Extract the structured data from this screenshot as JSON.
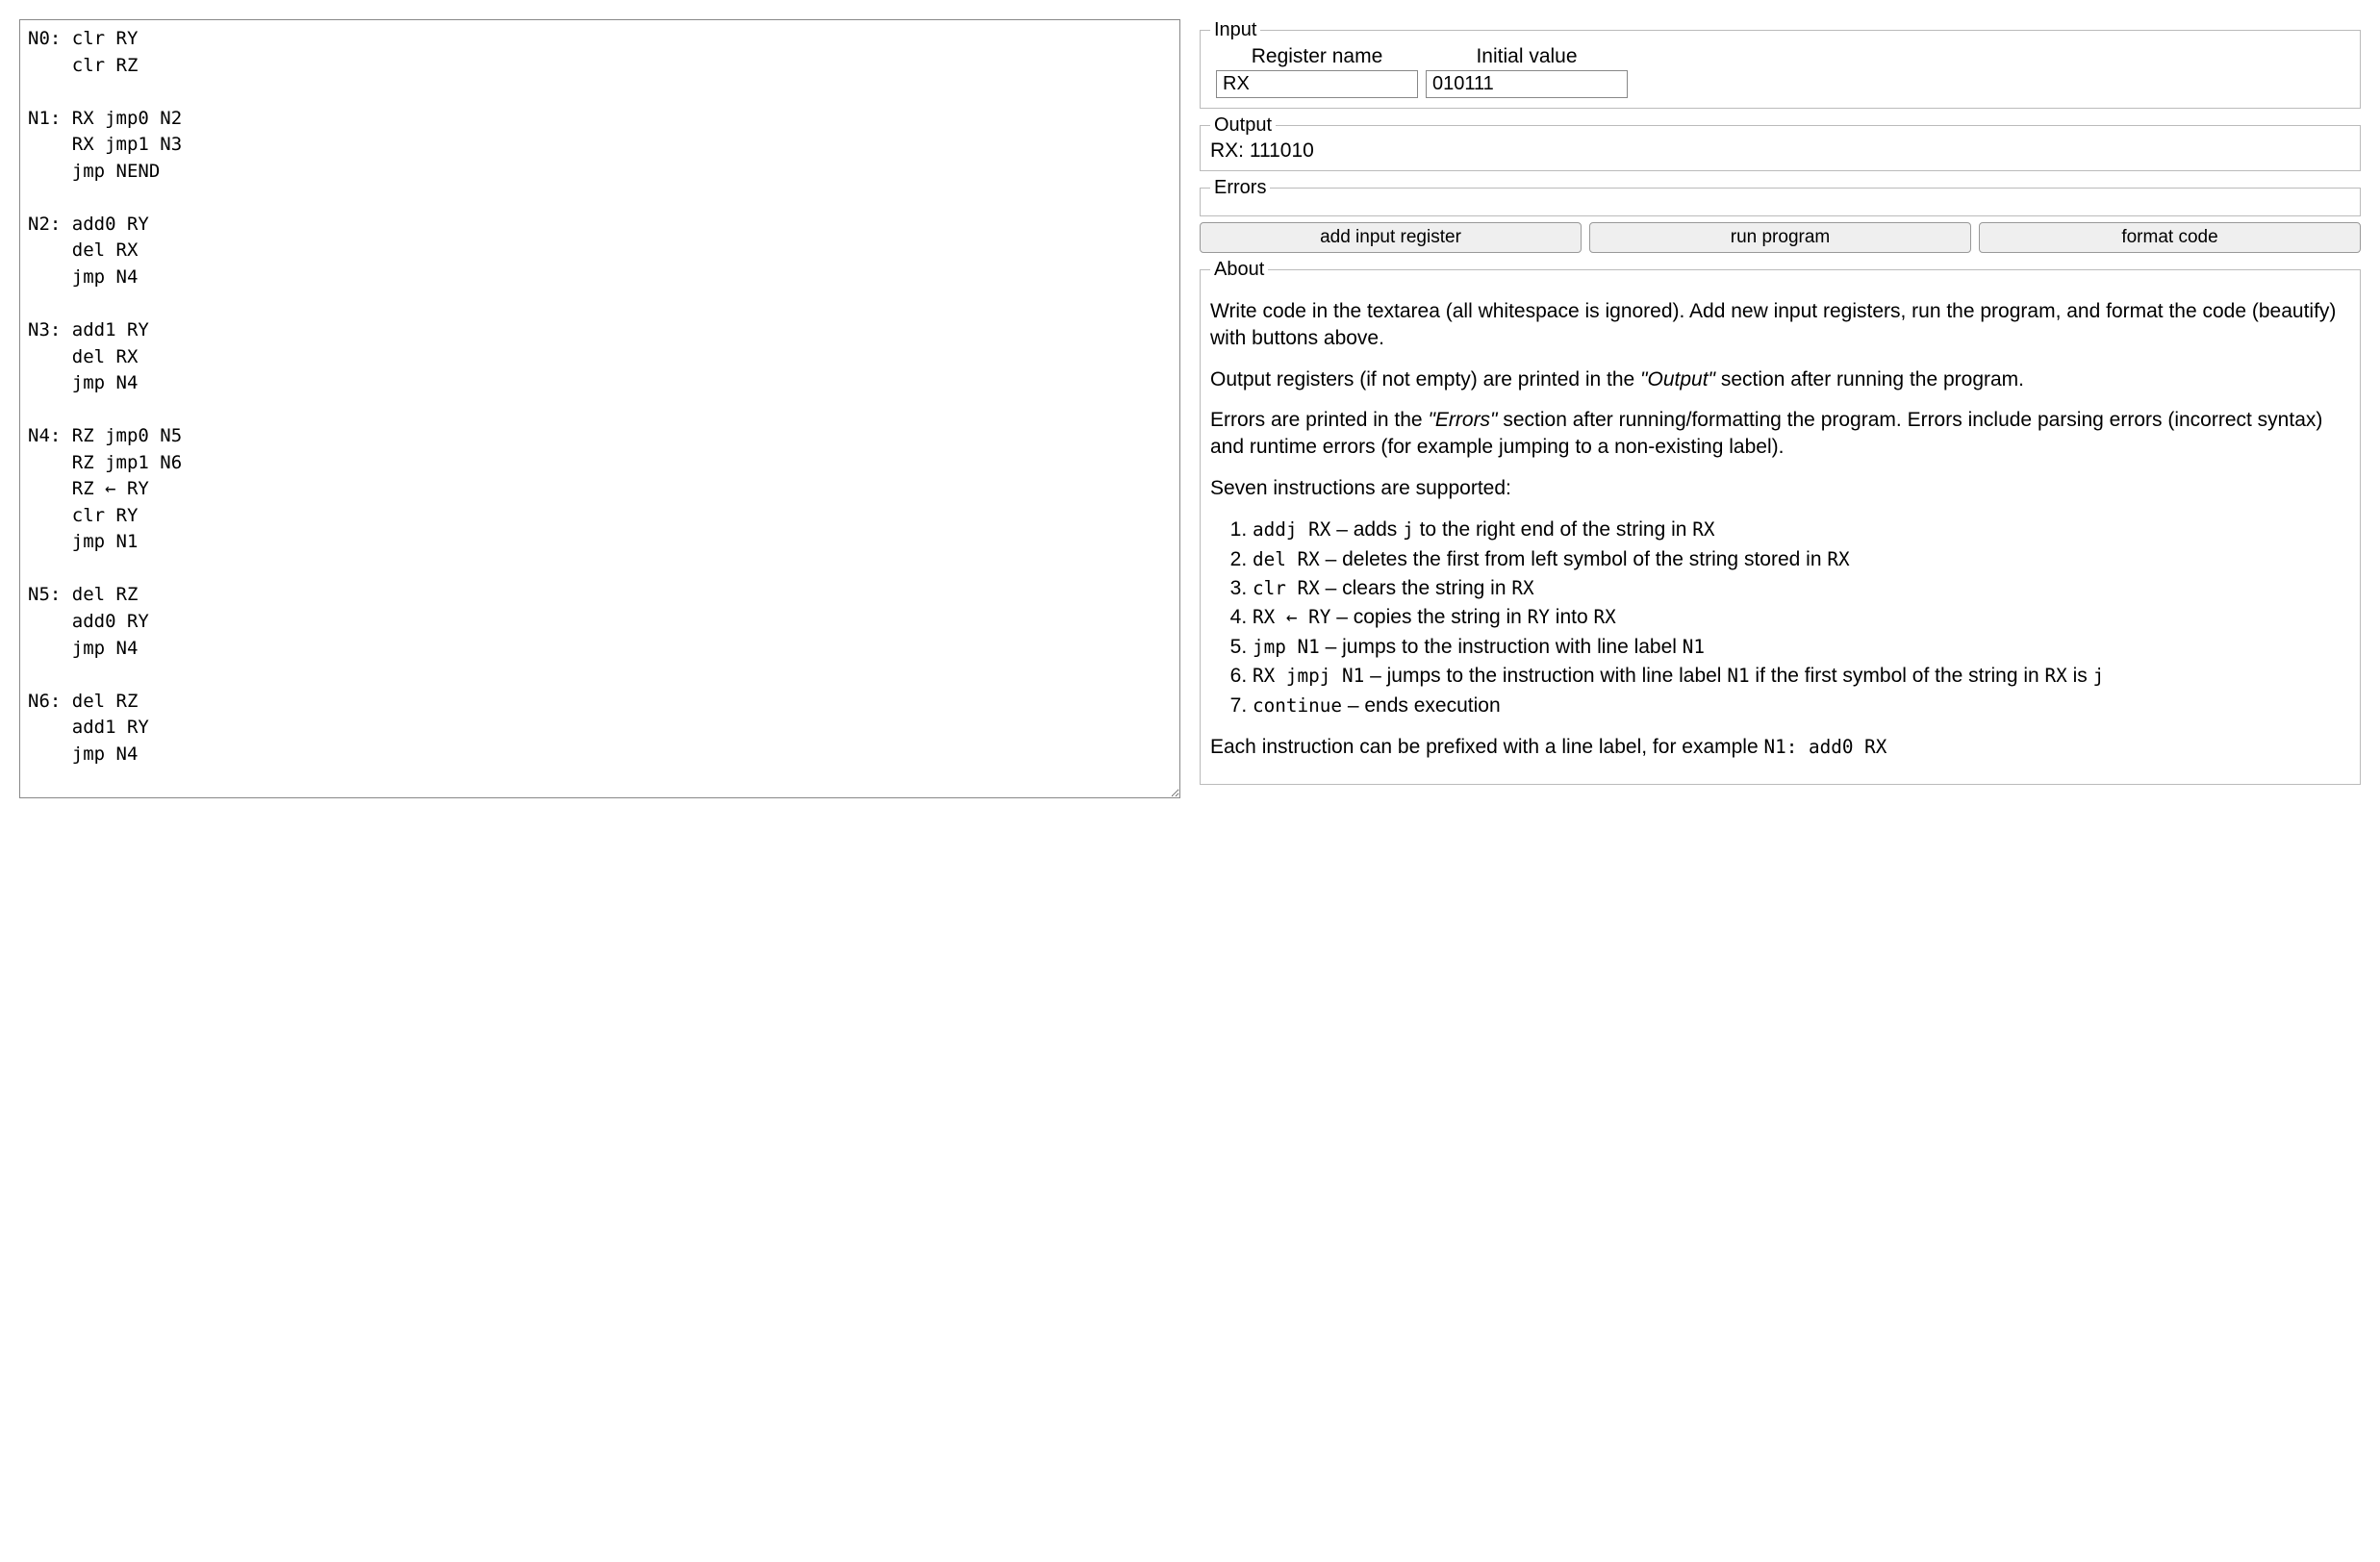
{
  "editor": {
    "code": "N0: clr RY\n    clr RZ\n\nN1: RX jmp0 N2\n    RX jmp1 N3\n    jmp NEND\n\nN2: add0 RY\n    del RX\n    jmp N4\n\nN3: add1 RY\n    del RX\n    jmp N4\n\nN4: RZ jmp0 N5\n    RZ jmp1 N6\n    RZ ← RY\n    clr RY\n    jmp N1\n\nN5: del RZ\n    add0 RY\n    jmp N4\n\nN6: del RZ\n    add1 RY\n    jmp N4\n\nNEND: RX ← RZ\n      clr RY\n      clr RZ\n      continue"
  },
  "input": {
    "legend": "Input",
    "header_register": "Register name",
    "header_value": "Initial value",
    "rows": [
      {
        "register": "RX",
        "value": "010111"
      }
    ]
  },
  "output": {
    "legend": "Output",
    "text": "RX: 111010"
  },
  "errors": {
    "legend": "Errors",
    "text": ""
  },
  "buttons": {
    "add_input": "add input register",
    "run": "run program",
    "format": "format code"
  },
  "about": {
    "legend": "About",
    "p1": "Write code in the textarea (all whitespace is ignored). Add new input registers, run the program, and format the code (beautify) with buttons above.",
    "p2_a": "Output registers (if not empty) are printed in the ",
    "p2_em": "\"Output\"",
    "p2_b": " section after running the program.",
    "p3_a": "Errors are printed in the ",
    "p3_em": "\"Errors\"",
    "p3_b": " section after running/formatting the program. Errors include parsing errors (incorrect syntax) and runtime errors (for example jumping to a non-existing label).",
    "p4": "Seven instructions are supported:",
    "instr": [
      {
        "code1": "addj RX",
        "t1": " – adds ",
        "code2": "j",
        "t2": " to the right end of the string in ",
        "code3": "RX",
        "t3": ""
      },
      {
        "code1": "del RX",
        "t1": " – deletes the first from left symbol of the string stored in ",
        "code2": "RX",
        "t2": "",
        "code3": "",
        "t3": ""
      },
      {
        "code1": "clr RX",
        "t1": " – clears the string in ",
        "code2": "RX",
        "t2": "",
        "code3": "",
        "t3": ""
      },
      {
        "code1": "RX ← RY",
        "t1": " – copies the string in ",
        "code2": "RY",
        "t2": " into ",
        "code3": "RX",
        "t3": ""
      },
      {
        "code1": "jmp N1",
        "t1": " – jumps to the instruction with line label ",
        "code2": "N1",
        "t2": "",
        "code3": "",
        "t3": ""
      },
      {
        "code1": "RX jmpj N1",
        "t1": " – jumps to the instruction with line label ",
        "code2": "N1",
        "t2": " if the first symbol of the string in ",
        "code3": "RX",
        "t3": " is ",
        "code4": "j"
      },
      {
        "code1": "continue",
        "t1": " – ends execution",
        "code2": "",
        "t2": "",
        "code3": "",
        "t3": ""
      }
    ],
    "p5_a": "Each instruction can be prefixed with a line label, for example ",
    "p5_code": "N1: add0 RX"
  }
}
